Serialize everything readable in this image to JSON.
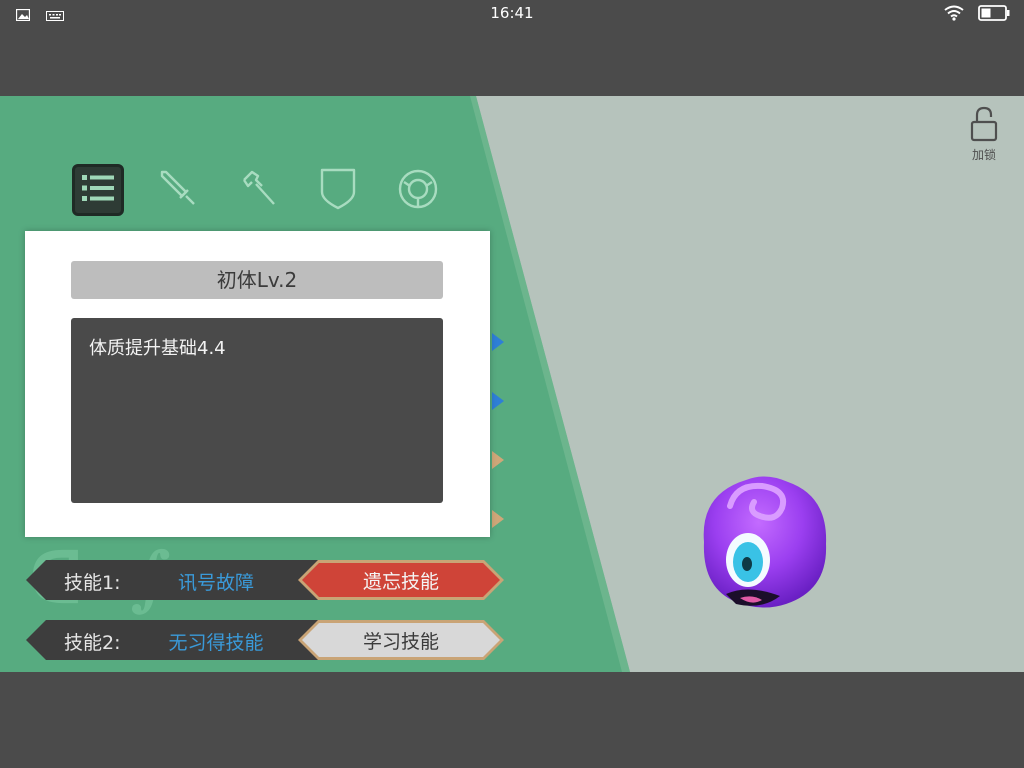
{
  "status_bar": {
    "time": "16:41",
    "left_icons": [
      "image-icon",
      "keyboard-icon"
    ],
    "right_icons": [
      "wifi-icon",
      "battery-icon"
    ]
  },
  "tabs": [
    {
      "name": "list-icon",
      "active": true
    },
    {
      "name": "sword-icon",
      "active": false
    },
    {
      "name": "axe-icon",
      "active": false
    },
    {
      "name": "shield-icon",
      "active": false
    },
    {
      "name": "ring-icon",
      "active": false
    }
  ],
  "lock": {
    "label": "加锁",
    "icon": "unlock-icon"
  },
  "popup": {
    "title": "初体Lv.2",
    "description": "体质提升基础4.4"
  },
  "skills": [
    {
      "label": "技能1:",
      "skill": "讯号故障",
      "button": "遗忘技能"
    },
    {
      "label": "技能2:",
      "skill": "无习得技能",
      "button": "学习技能"
    }
  ],
  "colors": {
    "panel_green": "#57ab80",
    "background": "#b6c3bc",
    "skill_blue": "#3a9ad9",
    "forget_red": "#cf4438",
    "monster_purple": "#9b3ff0"
  }
}
